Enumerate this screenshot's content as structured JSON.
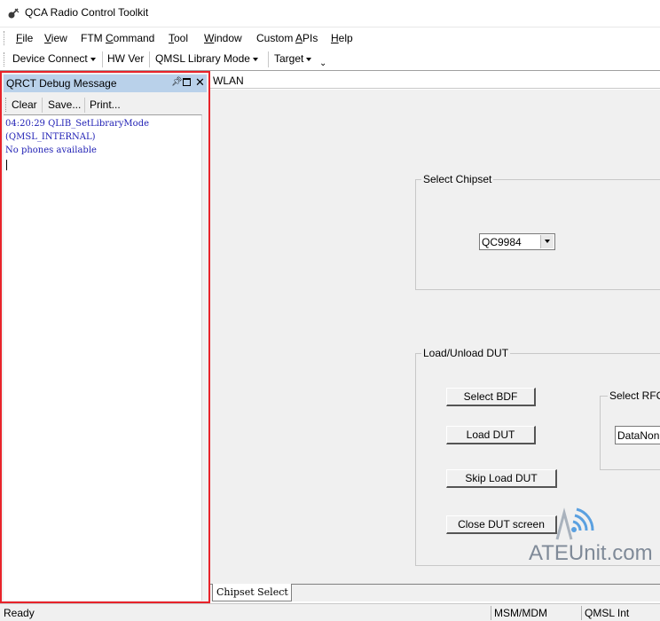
{
  "window": {
    "title": "QCA Radio Control Toolkit"
  },
  "menubar": {
    "items": [
      {
        "text": "File",
        "ul": "F",
        "rest": "ile"
      },
      {
        "text": "View",
        "ul": "V",
        "rest": "iew"
      },
      {
        "text": "FTM Command",
        "pre": "FTM ",
        "ul": "C",
        "rest": "ommand"
      },
      {
        "text": "Tool",
        "ul": "T",
        "rest": "ool"
      },
      {
        "text": "Window",
        "ul": "W",
        "rest": "indow"
      },
      {
        "text": "Custom APIs",
        "pre": "Custom ",
        "ul": "A",
        "rest": "PIs"
      },
      {
        "text": "Help",
        "ul": "H",
        "rest": "elp"
      }
    ]
  },
  "toolbar": {
    "device_connect": "Device Connect",
    "hw_ver": "HW Ver",
    "qmsl_mode": "QMSL Library Mode",
    "target": "Target"
  },
  "debug_panel": {
    "title": "QRCT Debug Message",
    "clear_label": "Clear",
    "save_label": "Save...",
    "print_label": "Print...",
    "log_lines": [
      "04:20:29  QLIB_SetLibraryMode",
      "(QMSL_INTERNAL)",
      "No phones available"
    ]
  },
  "wlan": {
    "tab_label": "WLAN",
    "select_chipset": {
      "label": "Select Chipset",
      "value": "QC9984"
    },
    "load_unload": {
      "label": "Load/Unload DUT",
      "select_bdf_label": "Select BDF",
      "load_dut_label": "Load DUT",
      "skip_load_label": "Skip Load DUT",
      "close_dut_label": "Close DUT screen",
      "select_rf_label": "Select RFC",
      "rf_value": "DataNon"
    }
  },
  "bottom_tab": {
    "label": "Chipset Select"
  },
  "status_bar": {
    "ready": "Ready",
    "msm": "MSM/MDM",
    "qmsl": "QMSL Int"
  },
  "watermark": {
    "text": "ATEUnit.com"
  },
  "colors": {
    "highlight_border": "#e8232a",
    "panel_title_bg": "#b9d1ea",
    "log_text": "#1e1eb4",
    "window_bg": "#f0f0f0"
  }
}
